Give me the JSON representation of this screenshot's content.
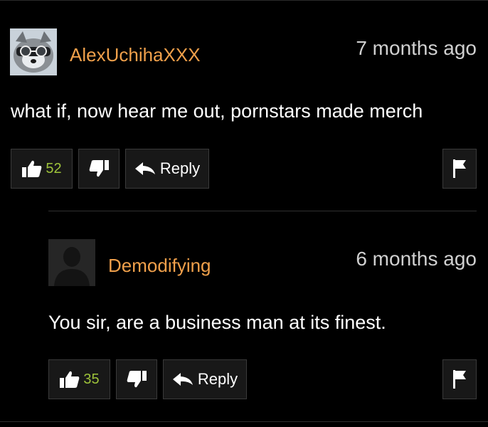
{
  "comments": [
    {
      "username": "AlexUchihaXXX",
      "timestamp": "7 months ago",
      "text": "what if, now hear me out, pornstars made merch",
      "likes": "52",
      "reply_label": "Reply",
      "avatar": "raccoon-with-sunglasses"
    },
    {
      "username": "Demodifying",
      "timestamp": "6 months ago",
      "text": "You sir, are a business man at its finest.",
      "likes": "35",
      "reply_label": "Reply",
      "avatar": "default-silhouette"
    }
  ],
  "colors": {
    "username": "#f0a04b",
    "like_count": "#9ec33a",
    "background": "#000000"
  }
}
